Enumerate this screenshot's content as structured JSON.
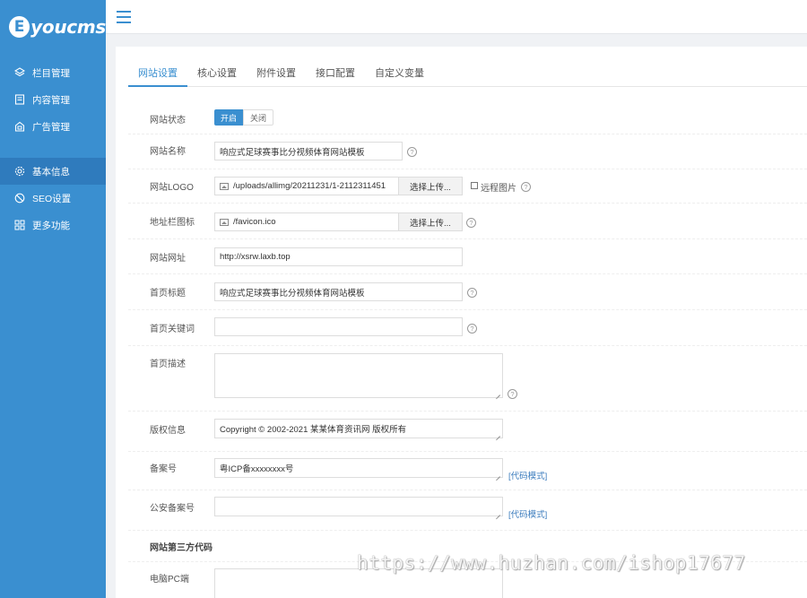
{
  "logo": {
    "badge": "E",
    "text": "youcms"
  },
  "sidebar": {
    "group1": [
      {
        "label": "栏目管理",
        "icon": "layers-icon"
      },
      {
        "label": "内容管理",
        "icon": "document-icon"
      },
      {
        "label": "广告管理",
        "icon": "ad-icon"
      }
    ],
    "group2": [
      {
        "label": "基本信息",
        "icon": "gear-icon",
        "active": true
      },
      {
        "label": "SEO设置",
        "icon": "seo-icon"
      },
      {
        "label": "更多功能",
        "icon": "grid-icon"
      }
    ]
  },
  "tabs": [
    {
      "label": "网站设置",
      "active": true
    },
    {
      "label": "核心设置"
    },
    {
      "label": "附件设置"
    },
    {
      "label": "接口配置"
    },
    {
      "label": "自定义变量"
    }
  ],
  "form": {
    "status": {
      "label": "网站状态",
      "on": "开启",
      "off": "关闭"
    },
    "site_name": {
      "label": "网站名称",
      "value": "响应式足球赛事比分视频体育网站模板"
    },
    "logo": {
      "label": "网站LOGO",
      "value": "/uploads/allimg/20211231/1-2112311451",
      "upload": "选择上传...",
      "remote": "远程图片"
    },
    "favicon": {
      "label": "地址栏图标",
      "value": "/favicon.ico",
      "upload": "选择上传..."
    },
    "url": {
      "label": "网站网址",
      "value": "http://xsrw.laxb.top"
    },
    "home_title": {
      "label": "首页标题",
      "value": "响应式足球赛事比分视频体育网站模板"
    },
    "home_keywords": {
      "label": "首页关键词",
      "value": ""
    },
    "home_desc": {
      "label": "首页描述",
      "value": ""
    },
    "copyright": {
      "label": "版权信息",
      "value": "Copyright © 2002-2021 某某体育资讯网 版权所有"
    },
    "icp": {
      "label": "备案号",
      "value": "粤ICP备xxxxxxxx号",
      "link": "[代码模式]"
    },
    "police": {
      "label": "公安备案号",
      "value": "",
      "link": "[代码模式]"
    },
    "third_party_title": "网站第三方代码",
    "pc_code": {
      "label": "电脑PC端"
    }
  },
  "help_glyph": "?",
  "watermark": "https://www.huzhan.com/ishop17677",
  "colors": {
    "brand": "#3a8fd0",
    "active_nav": "#2f7bbd",
    "link": "#3a7bbd"
  }
}
